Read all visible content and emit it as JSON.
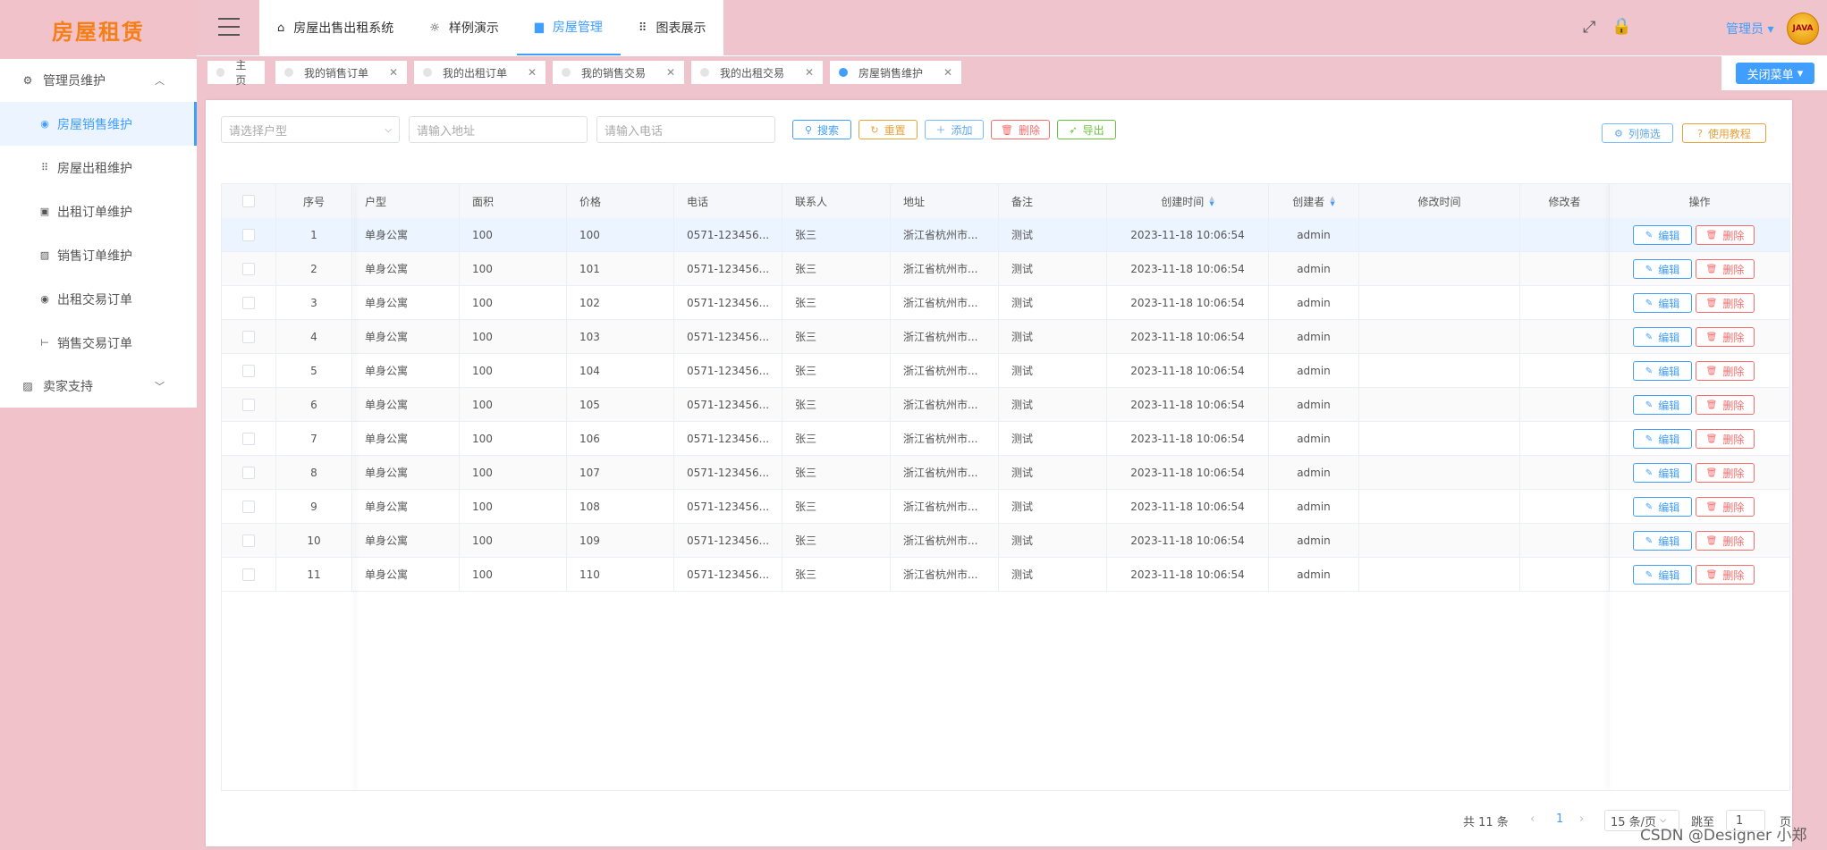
{
  "app": {
    "logo": "房屋租赁"
  },
  "sidebar": {
    "groups": [
      {
        "label": "管理员维护",
        "icon": "gear-icon",
        "chevron": "^",
        "items": [
          {
            "label": "房屋销售维护",
            "icon": "circle-icon",
            "active": true
          },
          {
            "label": "房屋出租维护",
            "icon": "grid-icon"
          },
          {
            "label": "出租订单维护",
            "icon": "lock-box-icon"
          },
          {
            "label": "销售订单维护",
            "icon": "chart-icon"
          },
          {
            "label": "出租交易订单",
            "icon": "circle-icon"
          },
          {
            "label": "销售交易订单",
            "icon": "dumbbell-icon"
          }
        ]
      },
      {
        "label": "卖家支持",
        "icon": "chart-icon",
        "chevron": "v"
      }
    ]
  },
  "topbar": {
    "tabs": [
      {
        "label": "房屋出售出租系统",
        "icon": "home-icon"
      },
      {
        "label": "样例演示",
        "icon": "sun-icon"
      },
      {
        "label": "房屋管理",
        "icon": "database-icon",
        "active": true
      },
      {
        "label": "图表展示",
        "icon": "grid-icon"
      }
    ],
    "user": "管理员",
    "avatar_text": "JAVA"
  },
  "tags": [
    {
      "label": "主页",
      "closable": false
    },
    {
      "label": "我的销售订单",
      "closable": true
    },
    {
      "label": "我的出租订单",
      "closable": true
    },
    {
      "label": "我的销售交易",
      "closable": true
    },
    {
      "label": "我的出租交易",
      "closable": true
    },
    {
      "label": "房屋销售维护",
      "closable": true,
      "active": true
    }
  ],
  "close_menu": "关闭菜单",
  "filters": {
    "house_type_placeholder": "请选择户型",
    "address_placeholder": "请输入地址",
    "phone_placeholder": "请输入电话"
  },
  "toolbar": {
    "search": "搜索",
    "reset": "重置",
    "add": "添加",
    "delete": "删除",
    "export": "导出",
    "column_filter": "列筛选",
    "tutorial": "使用教程"
  },
  "table": {
    "headers": {
      "index": "序号",
      "type": "户型",
      "area": "面积",
      "price": "价格",
      "phone": "电话",
      "contact": "联系人",
      "address": "地址",
      "remark": "备注",
      "created_time": "创建时间",
      "creator": "创建者",
      "modified_time": "修改时间",
      "modifier": "修改者",
      "actions": "操作"
    },
    "edit_label": "编辑",
    "delete_label": "删除",
    "rows": [
      {
        "index": "1",
        "type": "单身公寓",
        "area": "100",
        "price": "100",
        "phone": "0571-123456...",
        "contact": "张三",
        "address": "浙江省杭州市...",
        "remark": "测试",
        "created_time": "2023-11-18 10:06:54",
        "creator": "admin"
      },
      {
        "index": "2",
        "type": "单身公寓",
        "area": "100",
        "price": "101",
        "phone": "0571-123456...",
        "contact": "张三",
        "address": "浙江省杭州市...",
        "remark": "测试",
        "created_time": "2023-11-18 10:06:54",
        "creator": "admin"
      },
      {
        "index": "3",
        "type": "单身公寓",
        "area": "100",
        "price": "102",
        "phone": "0571-123456...",
        "contact": "张三",
        "address": "浙江省杭州市...",
        "remark": "测试",
        "created_time": "2023-11-18 10:06:54",
        "creator": "admin"
      },
      {
        "index": "4",
        "type": "单身公寓",
        "area": "100",
        "price": "103",
        "phone": "0571-123456...",
        "contact": "张三",
        "address": "浙江省杭州市...",
        "remark": "测试",
        "created_time": "2023-11-18 10:06:54",
        "creator": "admin"
      },
      {
        "index": "5",
        "type": "单身公寓",
        "area": "100",
        "price": "104",
        "phone": "0571-123456...",
        "contact": "张三",
        "address": "浙江省杭州市...",
        "remark": "测试",
        "created_time": "2023-11-18 10:06:54",
        "creator": "admin"
      },
      {
        "index": "6",
        "type": "单身公寓",
        "area": "100",
        "price": "105",
        "phone": "0571-123456...",
        "contact": "张三",
        "address": "浙江省杭州市...",
        "remark": "测试",
        "created_time": "2023-11-18 10:06:54",
        "creator": "admin"
      },
      {
        "index": "7",
        "type": "单身公寓",
        "area": "100",
        "price": "106",
        "phone": "0571-123456...",
        "contact": "张三",
        "address": "浙江省杭州市...",
        "remark": "测试",
        "created_time": "2023-11-18 10:06:54",
        "creator": "admin"
      },
      {
        "index": "8",
        "type": "单身公寓",
        "area": "100",
        "price": "107",
        "phone": "0571-123456...",
        "contact": "张三",
        "address": "浙江省杭州市...",
        "remark": "测试",
        "created_time": "2023-11-18 10:06:54",
        "creator": "admin"
      },
      {
        "index": "9",
        "type": "单身公寓",
        "area": "100",
        "price": "108",
        "phone": "0571-123456...",
        "contact": "张三",
        "address": "浙江省杭州市...",
        "remark": "测试",
        "created_time": "2023-11-18 10:06:54",
        "creator": "admin"
      },
      {
        "index": "10",
        "type": "单身公寓",
        "area": "100",
        "price": "109",
        "phone": "0571-123456...",
        "contact": "张三",
        "address": "浙江省杭州市...",
        "remark": "测试",
        "created_time": "2023-11-18 10:06:54",
        "creator": "admin"
      },
      {
        "index": "11",
        "type": "单身公寓",
        "area": "100",
        "price": "110",
        "phone": "0571-123456...",
        "contact": "张三",
        "address": "浙江省杭州市...",
        "remark": "测试",
        "created_time": "2023-11-18 10:06:54",
        "creator": "admin"
      }
    ]
  },
  "pagination": {
    "total": "共 11 条",
    "current_page": "1",
    "page_size": "15 条/页",
    "jump_label": "跳至",
    "jump_value": "1",
    "page_suffix": "页"
  },
  "watermark": "CSDN @Designer 小郑"
}
